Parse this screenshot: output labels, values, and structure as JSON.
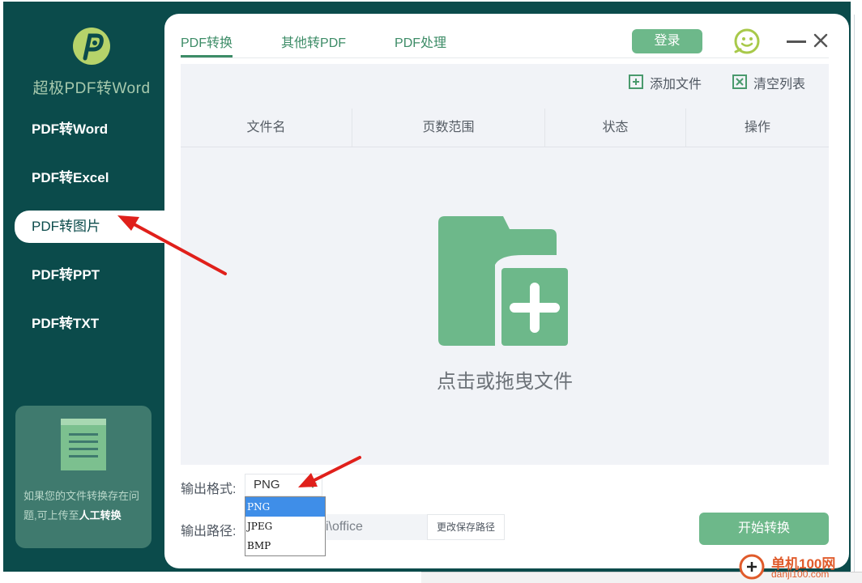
{
  "app": {
    "name": "超极PDF转Word",
    "help_text": "如果您的文件转换存在问题,可上传至",
    "help_link": "人工转换"
  },
  "sidebar": {
    "items": [
      {
        "label": "PDF转Word"
      },
      {
        "label": "PDF转Excel"
      },
      {
        "label": "PDF转图片"
      },
      {
        "label": "PDF转PPT"
      },
      {
        "label": "PDF转TXT"
      }
    ],
    "active_index": 2
  },
  "header": {
    "tabs": [
      {
        "label": "PDF转换"
      },
      {
        "label": "其他转PDF"
      },
      {
        "label": "PDF处理"
      }
    ],
    "login_label": "登录"
  },
  "toolbar": {
    "add_file": "添加文件",
    "clear_list": "清空列表"
  },
  "table": {
    "columns": [
      "文件名",
      "页数范围",
      "状态",
      "操作"
    ]
  },
  "drop_zone": {
    "text": "点击或拖曳文件"
  },
  "output": {
    "format_label": "输出格式:",
    "format_value": "PNG",
    "format_options": [
      "PNG",
      "JPEG",
      "BMP"
    ],
    "path_label": "输出路径:",
    "path_value": "i\\office",
    "change_path": "更改保存路径",
    "start": "开始转换"
  },
  "watermark": {
    "title": "单机100网",
    "url": "danji100.com"
  },
  "colors": {
    "sidebar": "#0b4b4b",
    "accent": "#6db88a",
    "annotation": "#e0201b"
  }
}
